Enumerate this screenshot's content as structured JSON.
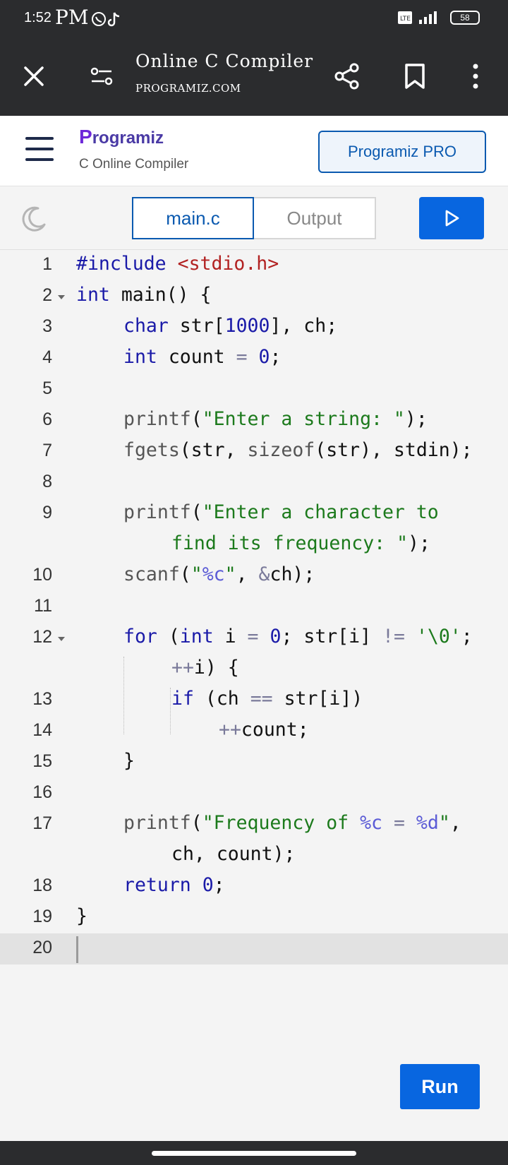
{
  "status_bar": {
    "time": "1:52",
    "carrier": "PM",
    "battery": "58",
    "icons": [
      "whatsapp-icon",
      "tiktok-icon",
      "volte-icon",
      "signal-icon",
      "battery-icon"
    ]
  },
  "browser": {
    "title": "Online C Compiler",
    "url": "PROGRAMIZ.COM"
  },
  "site": {
    "logo": "rogramiz",
    "logo_mark": "P",
    "subtitle": "C Online Compiler",
    "pro_button": "Programiz PRO"
  },
  "tabs": {
    "main": "main.c",
    "output": "Output"
  },
  "editor": {
    "line_numbers": [
      "1",
      "2",
      "3",
      "4",
      "5",
      "6",
      "7",
      "8",
      "9",
      "10",
      "11",
      "12",
      "13",
      "14",
      "15",
      "16",
      "17",
      "18",
      "19",
      "20"
    ],
    "active_line": "20"
  },
  "run_button": "Run",
  "colors": {
    "accent": "#0866e0",
    "keyword": "#1a1aa8",
    "string": "#1c7a1c",
    "include": "#b22222",
    "dark_bar": "#2b2c2e"
  }
}
